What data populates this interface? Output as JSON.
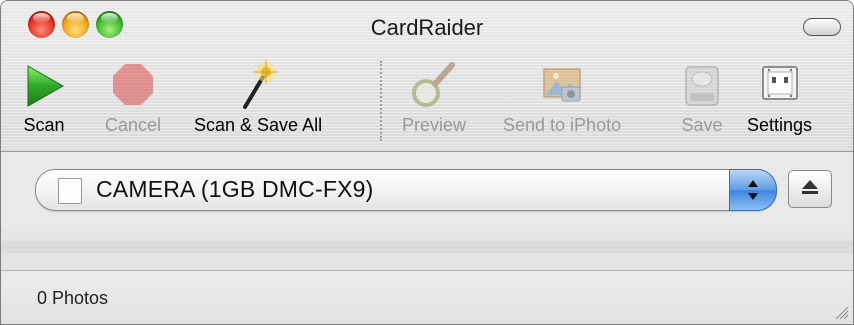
{
  "window": {
    "title": "CardRaider"
  },
  "toolbar": {
    "items": [
      {
        "label": "Scan",
        "icon": "play-icon",
        "enabled": true
      },
      {
        "label": "Cancel",
        "icon": "stop-icon",
        "enabled": false
      },
      {
        "label": "Scan & Save All",
        "icon": "magic-wand-icon",
        "enabled": true
      },
      {
        "label": "Preview",
        "icon": "magnifier-icon",
        "enabled": false
      },
      {
        "label": "Send to iPhoto",
        "icon": "iphoto-icon",
        "enabled": false
      },
      {
        "label": "Save",
        "icon": "disk-icon",
        "enabled": false
      },
      {
        "label": "Settings",
        "icon": "settings-switch-icon",
        "enabled": true
      }
    ]
  },
  "device": {
    "selected": "CAMERA (1GB DMC-FX9)"
  },
  "status": {
    "text": "0 Photos"
  },
  "colors": {
    "play_green": "#2ea82a",
    "stop_red": "#d9302a",
    "popup_blue": "#3e84e0"
  }
}
